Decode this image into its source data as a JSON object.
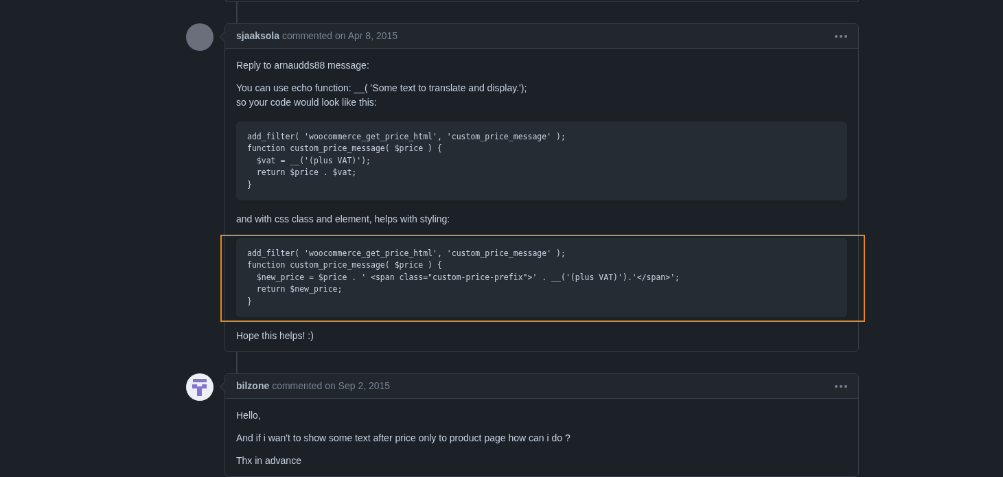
{
  "comments": [
    {
      "author": "sjaaksola",
      "meta": "commented on Apr 8, 2015",
      "avatar": {
        "kind": "photo"
      },
      "blocks": [
        {
          "kind": "text",
          "lines": [
            "Reply to arnaudds88 message:"
          ]
        },
        {
          "kind": "text",
          "lines": [
            "You can use echo function: __( 'Some text to translate and display.');",
            "so your code would look like this:"
          ]
        },
        {
          "kind": "code",
          "highlighted": false,
          "lines": [
            "add_filter( 'woocommerce_get_price_html', 'custom_price_message' );",
            "function custom_price_message( $price ) {",
            "  $vat = __('(plus VAT)');",
            "  return $price . $vat;",
            "}"
          ]
        },
        {
          "kind": "text",
          "lines": [
            "and with css class and element, helps with styling:"
          ]
        },
        {
          "kind": "code",
          "highlighted": true,
          "lines": [
            "add_filter( 'woocommerce_get_price_html', 'custom_price_message' );",
            "function custom_price_message( $price ) {",
            "  $new_price = $price . ' <span class=\"custom-price-prefix\">' . __('(plus VAT)').'</span>';",
            "  return $new_price;",
            "}"
          ]
        },
        {
          "kind": "text",
          "lines": [
            "Hope this helps! :)"
          ]
        }
      ]
    },
    {
      "author": "bilzone",
      "meta": "commented on Sep 2, 2015",
      "avatar": {
        "kind": "identicon"
      },
      "blocks": [
        {
          "kind": "text",
          "lines": [
            "Hello,"
          ]
        },
        {
          "kind": "text",
          "lines": [
            "And if i wan't to show some text after price only to product page how can i do ?"
          ]
        },
        {
          "kind": "text",
          "lines": [
            "Thx in advance"
          ]
        }
      ]
    }
  ]
}
